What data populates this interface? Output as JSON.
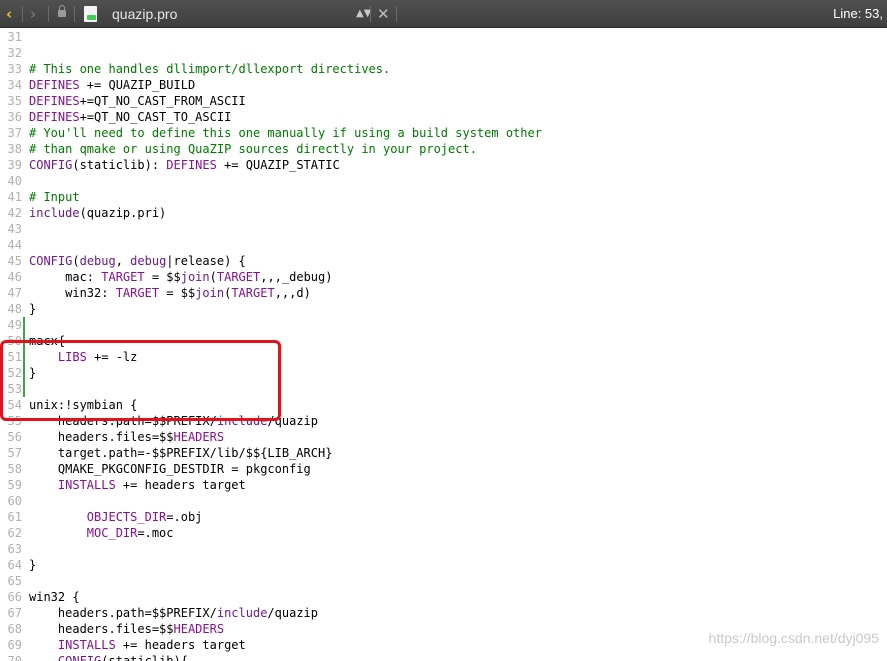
{
  "toolbar": {
    "back_glyph": "‹",
    "forward_glyph": "›",
    "filename": "quazip.pro",
    "updown_glyph": "▲▼",
    "close_glyph": "✕",
    "line_info": "Line: 53,"
  },
  "watermark": "https://blog.csdn.net/dyj095",
  "lines": [
    {
      "n": "31",
      "t": ""
    },
    {
      "n": "32",
      "t": ""
    },
    {
      "n": "33",
      "t": "# This one handles dllimport/dllexport directives.",
      "k": "comment"
    },
    {
      "n": "34",
      "t": "DEFINES += QUAZIP_BUILD"
    },
    {
      "n": "35",
      "t": "DEFINES+=QT_NO_CAST_FROM_ASCII"
    },
    {
      "n": "36",
      "t": "DEFINES+=QT_NO_CAST_TO_ASCII"
    },
    {
      "n": "37",
      "t": "# You'll need to define this one manually if using a build system other",
      "k": "comment"
    },
    {
      "n": "38",
      "t": "# than qmake or using QuaZIP sources directly in your project.",
      "k": "comment"
    },
    {
      "n": "39",
      "t": "CONFIG(staticlib): DEFINES += QUAZIP_STATIC"
    },
    {
      "n": "40",
      "t": ""
    },
    {
      "n": "41",
      "t": "# Input",
      "k": "comment"
    },
    {
      "n": "42",
      "t": "include(quazip.pri)"
    },
    {
      "n": "43",
      "t": ""
    },
    {
      "n": "44",
      "t": ""
    },
    {
      "n": "45",
      "t": "CONFIG(debug, debug|release) {"
    },
    {
      "n": "46",
      "t": "     mac: TARGET = $$join(TARGET,,,_debug)"
    },
    {
      "n": "47",
      "t": "     win32: TARGET = $$join(TARGET,,,d)"
    },
    {
      "n": "48",
      "t": "}"
    },
    {
      "n": "49",
      "t": "",
      "m": true
    },
    {
      "n": "50",
      "t": "macx{",
      "m": true
    },
    {
      "n": "51",
      "t": "    LIBS += -lz",
      "m": true
    },
    {
      "n": "52",
      "t": "}",
      "m": true
    },
    {
      "n": "53",
      "t": "",
      "m": true
    },
    {
      "n": "54",
      "t": "unix:!symbian {"
    },
    {
      "n": "55",
      "t": "    headers.path=$$PREFIX/include/quazip"
    },
    {
      "n": "56",
      "t": "    headers.files=$$HEADERS"
    },
    {
      "n": "57",
      "t": "    target.path=-$$PREFIX/lib/$${LIB_ARCH}"
    },
    {
      "n": "58",
      "t": "    QMAKE_PKGCONFIG_DESTDIR = pkgconfig"
    },
    {
      "n": "59",
      "t": "    INSTALLS += headers target"
    },
    {
      "n": "60",
      "t": ""
    },
    {
      "n": "61",
      "t": "        OBJECTS_DIR=.obj"
    },
    {
      "n": "62",
      "t": "        MOC_DIR=.moc"
    },
    {
      "n": "63",
      "t": ""
    },
    {
      "n": "64",
      "t": "}"
    },
    {
      "n": "65",
      "t": ""
    },
    {
      "n": "66",
      "t": "win32 {"
    },
    {
      "n": "67",
      "t": "    headers.path=$$PREFIX/include/quazip"
    },
    {
      "n": "68",
      "t": "    headers.files=$$HEADERS"
    },
    {
      "n": "69",
      "t": "    INSTALLS += headers target"
    },
    {
      "n": "70",
      "t": "    CONFIG(staticlib){"
    }
  ]
}
